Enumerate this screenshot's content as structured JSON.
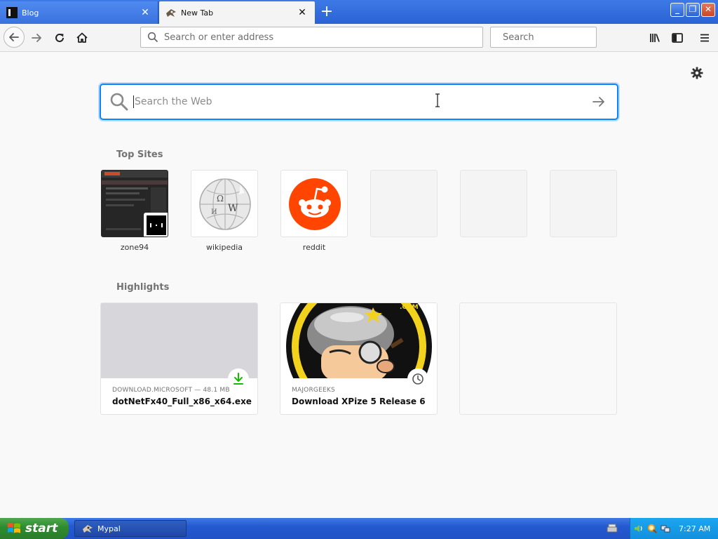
{
  "tabs": [
    {
      "title": "Blog",
      "favicon": "blog-favicon",
      "active": false
    },
    {
      "title": "New Tab",
      "favicon": "mypal-favicon",
      "active": true
    }
  ],
  "toolbar": {
    "url_placeholder": "Search or enter address",
    "search_placeholder": "Search"
  },
  "newtab": {
    "search_placeholder": "Search the Web",
    "top_sites_title": "Top Sites",
    "top_sites": [
      {
        "label": "zone94",
        "icon": "zone94-thumbnail"
      },
      {
        "label": "wikipedia",
        "icon": "wikipedia-globe-icon"
      },
      {
        "label": "reddit",
        "icon": "reddit-icon"
      },
      {
        "label": "",
        "icon": "empty"
      },
      {
        "label": "",
        "icon": "empty"
      },
      {
        "label": "",
        "icon": "empty"
      }
    ],
    "highlights_title": "Highlights",
    "highlights": [
      {
        "domain": "DOWNLOAD.MICROSOFT — 48.1 MB",
        "title": "dotNetFx40_Full_x86_x64.exe",
        "badge": "download-icon"
      },
      {
        "domain": "MAJORGEEKS",
        "title": "Download XPize 5 Release 6",
        "badge": "clock-icon"
      },
      {
        "domain": "",
        "title": "",
        "badge": ""
      }
    ]
  },
  "taskbar": {
    "start_label": "start",
    "tasks": [
      {
        "label": "Mypal",
        "icon": "mypal-icon"
      }
    ],
    "clock": "7:27 AM"
  },
  "colors": {
    "accent": "#0a84ff",
    "titlebar": "#2a63d4",
    "start": "#2f8a2f",
    "reddit": "#ff4500"
  }
}
